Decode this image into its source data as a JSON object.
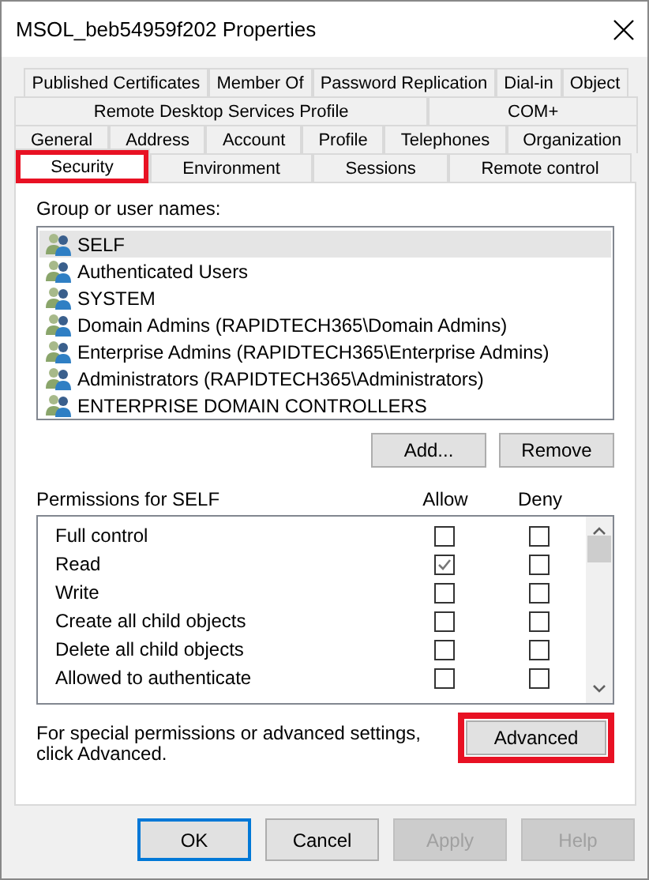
{
  "window": {
    "title": "MSOL_beb54959f202 Properties"
  },
  "tab_rows": [
    [
      {
        "label": "Published Certificates",
        "selected": false,
        "highlighted": false
      },
      {
        "label": "Member Of",
        "selected": false,
        "highlighted": false
      },
      {
        "label": "Password Replication",
        "selected": false,
        "highlighted": false
      },
      {
        "label": "Dial-in",
        "selected": false,
        "highlighted": false
      },
      {
        "label": "Object",
        "selected": false,
        "highlighted": false
      }
    ],
    [
      {
        "label": "Remote Desktop Services Profile",
        "selected": false,
        "highlighted": false
      },
      {
        "label": "COM+",
        "selected": false,
        "highlighted": false
      }
    ],
    [
      {
        "label": "General",
        "selected": false,
        "highlighted": false
      },
      {
        "label": "Address",
        "selected": false,
        "highlighted": false
      },
      {
        "label": "Account",
        "selected": false,
        "highlighted": false
      },
      {
        "label": "Profile",
        "selected": false,
        "highlighted": false
      },
      {
        "label": "Telephones",
        "selected": false,
        "highlighted": false
      },
      {
        "label": "Organization",
        "selected": false,
        "highlighted": false
      }
    ],
    [
      {
        "label": "Security",
        "selected": true,
        "highlighted": true
      },
      {
        "label": "Environment",
        "selected": false,
        "highlighted": false
      },
      {
        "label": "Sessions",
        "selected": false,
        "highlighted": false
      },
      {
        "label": "Remote control",
        "selected": false,
        "highlighted": false
      }
    ]
  ],
  "group_list": {
    "label": "Group or user names:",
    "items": [
      {
        "name": "SELF",
        "selected": true
      },
      {
        "name": "Authenticated Users",
        "selected": false
      },
      {
        "name": "SYSTEM",
        "selected": false
      },
      {
        "name": "Domain Admins (RAPIDTECH365\\Domain Admins)",
        "selected": false
      },
      {
        "name": "Enterprise Admins (RAPIDTECH365\\Enterprise Admins)",
        "selected": false
      },
      {
        "name": "Administrators (RAPIDTECH365\\Administrators)",
        "selected": false
      },
      {
        "name": "ENTERPRISE DOMAIN CONTROLLERS",
        "selected": false
      }
    ]
  },
  "group_buttons": [
    {
      "label": "Add..."
    },
    {
      "label": "Remove"
    }
  ],
  "permissions": {
    "label": "Permissions for SELF",
    "columns": [
      "Allow",
      "Deny"
    ],
    "rows": [
      {
        "name": "Full control",
        "allow": false,
        "deny": false
      },
      {
        "name": "Read",
        "allow": true,
        "deny": false
      },
      {
        "name": "Write",
        "allow": false,
        "deny": false
      },
      {
        "name": "Create all child objects",
        "allow": false,
        "deny": false
      },
      {
        "name": "Delete all child objects",
        "allow": false,
        "deny": false
      },
      {
        "name": "Allowed to authenticate",
        "allow": false,
        "deny": false
      }
    ]
  },
  "advanced": {
    "text": "For special permissions or advanced settings, click Advanced.",
    "button": {
      "label": "Advanced",
      "highlighted": true
    }
  },
  "buttons": [
    {
      "label": "OK",
      "disabled": false,
      "default": true
    },
    {
      "label": "Cancel",
      "disabled": false,
      "default": false
    },
    {
      "label": "Apply",
      "disabled": true,
      "default": false
    },
    {
      "label": "Help",
      "disabled": true,
      "default": false
    }
  ]
}
